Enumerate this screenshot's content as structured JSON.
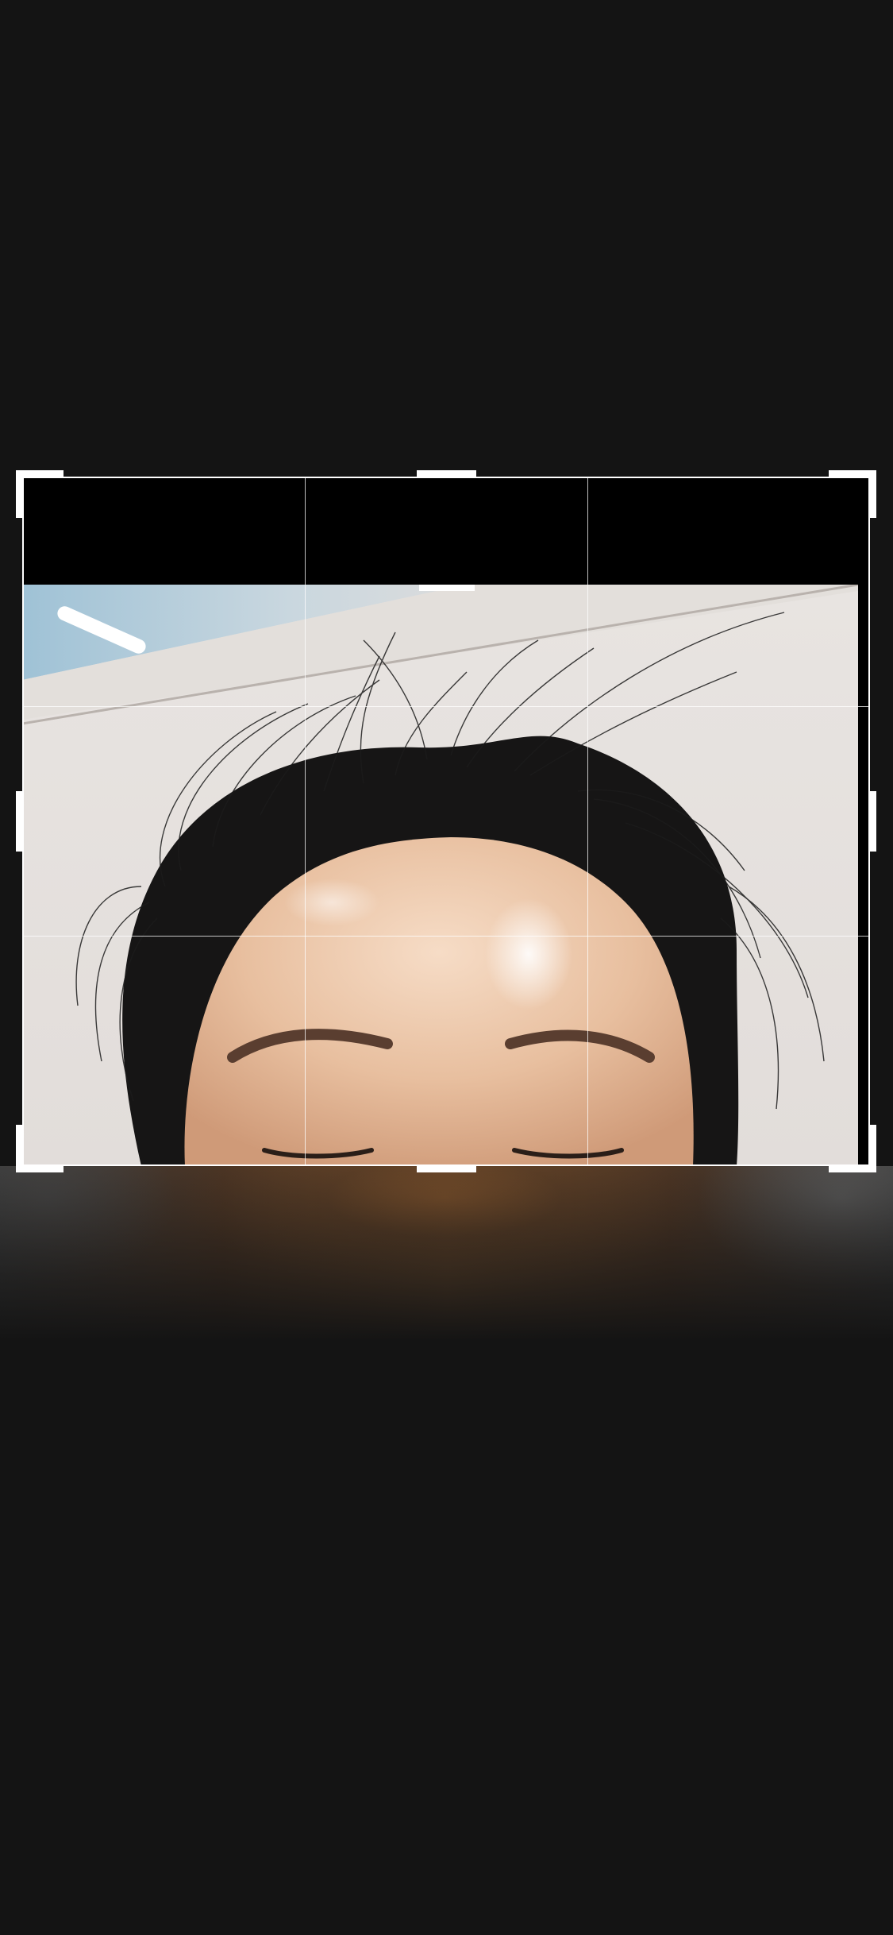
{
  "screen": {
    "background": "#141414",
    "mode": "photo-crop-editor"
  },
  "crop_frame": {
    "grid": "3x3",
    "border_color": "#ffffff",
    "letterbox_color": "#000000"
  },
  "photo": {
    "subject": "forehead-with-flyaway-hair-closeup",
    "wall_color": "#e6e2df",
    "hair_color": "#141414",
    "skin_color": "#e9c3a6"
  },
  "icons": {
    "corner_handle": "corner-bracket-icon",
    "edge_handle": "edge-bar-icon"
  }
}
